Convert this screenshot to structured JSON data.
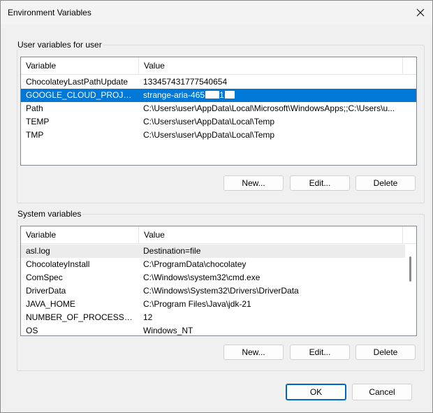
{
  "window": {
    "title": "Environment Variables"
  },
  "user_section": {
    "label": "User variables for user",
    "columns": [
      "Variable",
      "Value"
    ],
    "rows": [
      {
        "variable": "ChocolateyLastPathUpdate",
        "value": "133457431777540654"
      },
      {
        "variable": "GOOGLE_CLOUD_PROJECT",
        "value": "strange-aria-465",
        "value_tail": "1"
      },
      {
        "variable": "Path",
        "value": "C:\\Users\\user\\AppData\\Local\\Microsoft\\WindowsApps;;C:\\Users\\u..."
      },
      {
        "variable": "TEMP",
        "value": "C:\\Users\\user\\AppData\\Local\\Temp"
      },
      {
        "variable": "TMP",
        "value": "C:\\Users\\user\\AppData\\Local\\Temp"
      }
    ],
    "selected_index": 1,
    "buttons": {
      "new": "New...",
      "edit": "Edit...",
      "delete": "Delete"
    }
  },
  "system_section": {
    "label": "System variables",
    "columns": [
      "Variable",
      "Value"
    ],
    "rows": [
      {
        "variable": "asl.log",
        "value": "Destination=file"
      },
      {
        "variable": "ChocolateyInstall",
        "value": "C:\\ProgramData\\chocolatey"
      },
      {
        "variable": "ComSpec",
        "value": "C:\\Windows\\system32\\cmd.exe"
      },
      {
        "variable": "DriverData",
        "value": "C:\\Windows\\System32\\Drivers\\DriverData"
      },
      {
        "variable": "JAVA_HOME",
        "value": "C:\\Program Files\\Java\\jdk-21"
      },
      {
        "variable": "NUMBER_OF_PROCESSORS",
        "value": "12"
      },
      {
        "variable": "OS",
        "value": "Windows_NT"
      }
    ],
    "hot_index": 0,
    "buttons": {
      "new": "New...",
      "edit": "Edit...",
      "delete": "Delete"
    }
  },
  "footer": {
    "ok": "OK",
    "cancel": "Cancel"
  },
  "colors": {
    "selection": "#0078d7",
    "primary_border": "#0067c0",
    "dialog_bg": "#f0f0f0"
  },
  "icons": {
    "close": "close-icon"
  }
}
